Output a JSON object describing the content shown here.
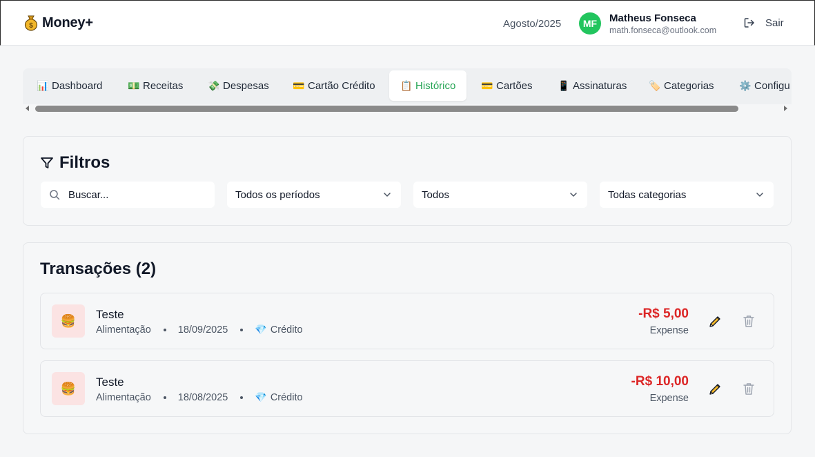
{
  "header": {
    "brand": "Money+",
    "period": "Agosto/2025",
    "user": {
      "initials": "MF",
      "name": "Matheus Fonseca",
      "email": "math.fonseca@outlook.com"
    },
    "logout_label": "Sair"
  },
  "tabs": [
    {
      "label": "Dashboard",
      "icon": "📊",
      "active": false
    },
    {
      "label": "Receitas",
      "icon": "💵",
      "active": false
    },
    {
      "label": "Despesas",
      "icon": "💸",
      "active": false
    },
    {
      "label": "Cartão Crédito",
      "icon": "💳",
      "active": false
    },
    {
      "label": "Histórico",
      "icon": "📋",
      "active": true
    },
    {
      "label": "Cartões",
      "icon": "💳",
      "active": false
    },
    {
      "label": "Assinaturas",
      "icon": "📱",
      "active": false
    },
    {
      "label": "Categorias",
      "icon": "🏷️",
      "active": false
    },
    {
      "label": "Configu",
      "icon": "⚙️",
      "active": false
    }
  ],
  "filters": {
    "title": "Filtros",
    "search_placeholder": "Buscar...",
    "period_select": "Todos os períodos",
    "type_select": "Todos",
    "category_select": "Todas categorias"
  },
  "transactions": {
    "title": "Transações (2)",
    "items": [
      {
        "name": "Teste",
        "category": "Alimentação",
        "date": "18/09/2025",
        "payment_icon": "💎",
        "payment": "Crédito",
        "amount": "-R$ 5,00",
        "type": "Expense",
        "icon": "🍔"
      },
      {
        "name": "Teste",
        "category": "Alimentação",
        "date": "18/08/2025",
        "payment_icon": "💎",
        "payment": "Crédito",
        "amount": "-R$ 10,00",
        "type": "Expense",
        "icon": "🍔"
      }
    ]
  },
  "colors": {
    "accent": "#22a352",
    "avatar": "#22c55e",
    "expense": "#dc2626",
    "icon_bg": "#fbe3e3"
  }
}
